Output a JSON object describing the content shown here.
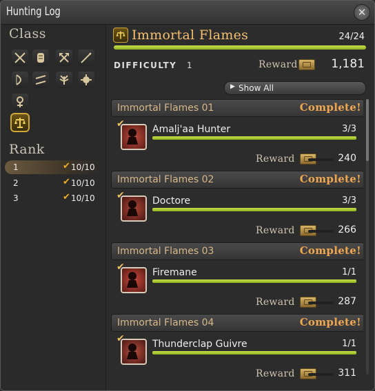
{
  "window": {
    "title": "Hunting Log"
  },
  "left": {
    "class_label": "Class",
    "rank_label": "Rank",
    "class_icons": [
      "gladiator-icon",
      "pugilist-icon",
      "marauder-icon",
      "lancer-icon",
      "archer-icon",
      "rogue-icon",
      "conjurer-icon",
      "thaumaturge-icon",
      "arcanist-icon",
      "grand-company-icon"
    ],
    "ranks": [
      {
        "rank": "1",
        "progress": "10/10",
        "selected": true
      },
      {
        "rank": "2",
        "progress": "10/10",
        "selected": false
      },
      {
        "rank": "3",
        "progress": "10/10",
        "selected": false
      }
    ]
  },
  "log": {
    "title": "Immortal Flames",
    "progress_text": "24/24",
    "progress_fraction": 1.0,
    "difficulty_label": "Difficulty",
    "difficulty_value": "1",
    "reward_label": "Reward",
    "reward_value": "1,181",
    "show_all": "Show All"
  },
  "entries": [
    {
      "name": "Immortal Flames 01",
      "status": "Complete!",
      "mob": "Amalj'aa Hunter",
      "count": "3/3",
      "fill": 1.0,
      "reward_label": "Reward",
      "reward": "240"
    },
    {
      "name": "Immortal Flames 02",
      "status": "Complete!",
      "mob": "Doctore",
      "count": "3/3",
      "fill": 1.0,
      "reward_label": "Reward",
      "reward": "266"
    },
    {
      "name": "Immortal Flames 03",
      "status": "Complete!",
      "mob": "Firemane",
      "count": "1/1",
      "fill": 1.0,
      "reward_label": "Reward",
      "reward": "287"
    },
    {
      "name": "Immortal Flames 04",
      "status": "Complete!",
      "mob": "Thunderclap Guivre",
      "count": "1/1",
      "fill": 1.0,
      "reward_label": "Reward",
      "reward": "311"
    }
  ]
}
